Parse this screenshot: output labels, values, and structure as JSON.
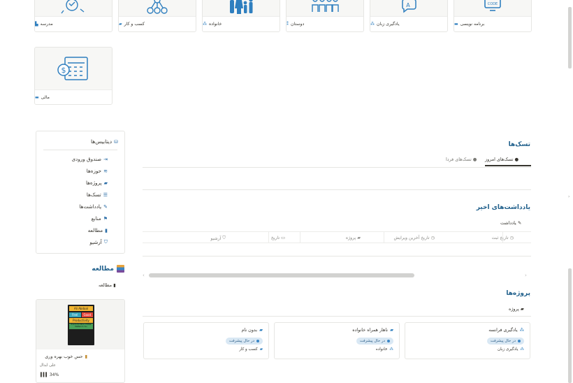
{
  "categories": [
    {
      "label": "برنامه نویسی",
      "icon": "code-monitor-icon"
    },
    {
      "label": "یادگیری زبان",
      "icon": "language-chat-icon"
    },
    {
      "label": "دوستان",
      "icon": "friends-icon"
    },
    {
      "label": "خانواده",
      "icon": "family-icon"
    },
    {
      "label": "کسب و کار",
      "icon": "business-network-icon"
    },
    {
      "label": "مدرسه",
      "icon": "school-icon"
    },
    {
      "label": "مالی",
      "icon": "calculator-icon"
    }
  ],
  "sidebar": {
    "title": "دیتابیس‌ها",
    "items": [
      {
        "label": "صندوق ورودی",
        "icon": "inbox-icon"
      },
      {
        "label": "حوزه‌ها",
        "icon": "layers-icon"
      },
      {
        "label": "پروژه‌ها",
        "icon": "briefcase-icon"
      },
      {
        "label": "تسک‌ها",
        "icon": "tasks-icon"
      },
      {
        "label": "یادداشت‌ها",
        "icon": "note-icon"
      },
      {
        "label": "منابع",
        "icon": "flag-icon"
      },
      {
        "label": "مطالعه",
        "icon": "book-icon"
      },
      {
        "label": "آرشیو",
        "icon": "archive-icon"
      }
    ]
  },
  "reading": {
    "title": "مطالعه",
    "view_label": "مطالعه",
    "book": {
      "cover_lines": [
        "Ali Abdaal",
        "Feel",
        "Good",
        "Productivity",
        "How to Do More of What Matters to You"
      ],
      "title": "حس خوب بهره وری",
      "author": "علی ابدال",
      "progress_text": "34%",
      "progress": 0.34
    }
  },
  "tasks": {
    "title": "تسک‌ها",
    "tabs": [
      {
        "label": "تسک‌های امروز",
        "active": true
      },
      {
        "label": "تسک‌های فردا",
        "active": false
      }
    ]
  },
  "notes": {
    "title": "یادداشت‌های اخیر",
    "view_label": "یادداشت",
    "columns": [
      "تاریخ ثبت",
      "تاریخ آخرین ویرایش",
      "پروژه",
      "تاریخ",
      "آرشیو"
    ]
  },
  "projects": {
    "title": "پروژه‌ها",
    "view_label": "پروژه",
    "cards": [
      {
        "title": "یادگیری فرانسه",
        "status": "در حال پیشرفت",
        "category": "یادگیری زبان"
      },
      {
        "title": "ناهار همراه خانواده",
        "status": "در حال پیشرفت",
        "category": "خانواده"
      },
      {
        "title": "بدون نام",
        "status": "در حال پیشرفت",
        "category": "کسب و کار"
      }
    ]
  },
  "colors": {
    "accent": "#2f7fbf",
    "heading": "#1f5f8b",
    "badge_bg": "#d9e8f4"
  }
}
